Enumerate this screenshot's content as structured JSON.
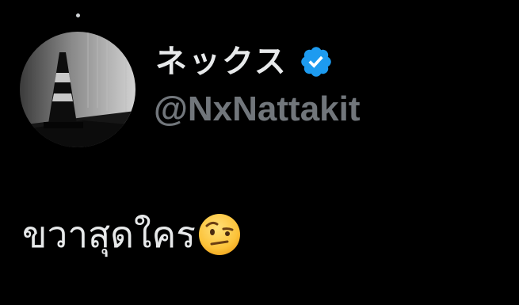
{
  "tweet": {
    "author": {
      "display_name": "ネックス",
      "handle": "@NxNattakit",
      "verified": true,
      "verified_badge_icon": "verified-badge-icon",
      "verified_color": "#1d9bf0"
    },
    "text": "ขวาสุดใคร",
    "emoji_icon": "face-with-raised-eyebrow-icon"
  },
  "colors": {
    "background": "#000000",
    "text_primary": "#e7e9ea",
    "text_secondary": "#71767b"
  }
}
